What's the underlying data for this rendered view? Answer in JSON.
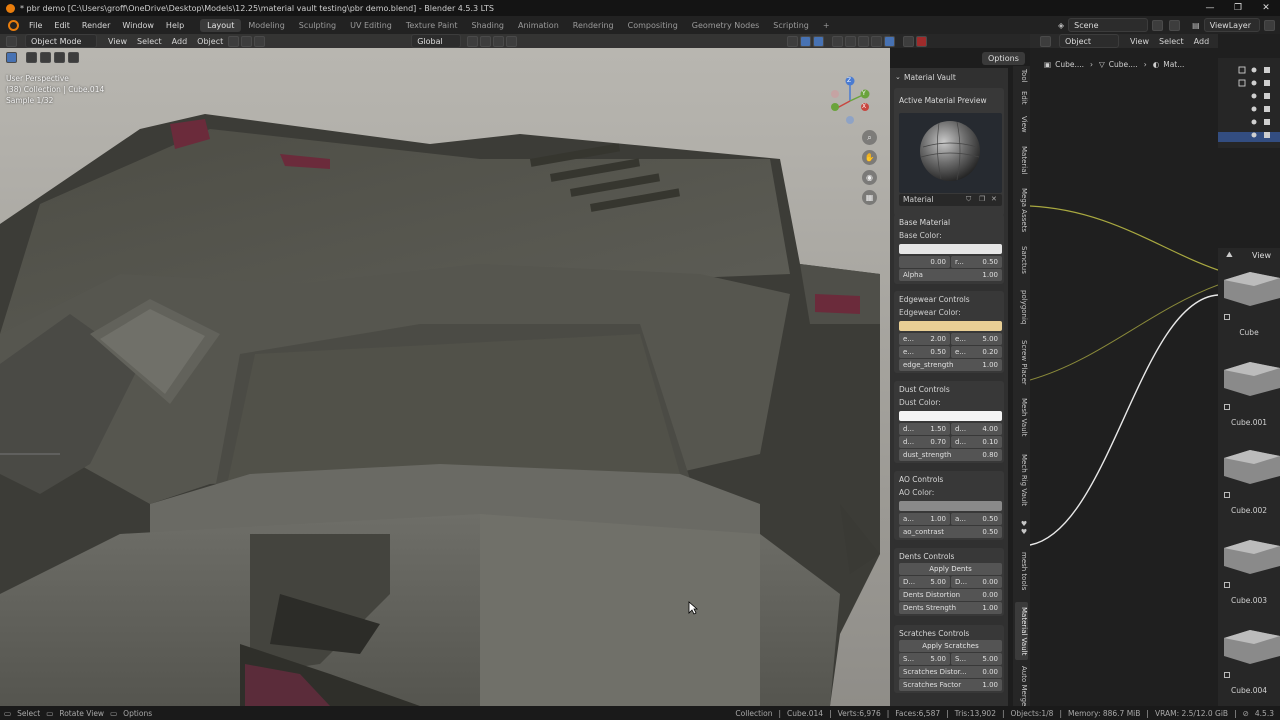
{
  "window": {
    "title": "* pbr demo [C:\\Users\\groff\\OneDrive\\Desktop\\Models\\12.25\\material vault testing\\pbr demo.blend] - Blender 4.5.3 LTS",
    "controls": [
      "—",
      "❐",
      "✕"
    ]
  },
  "menubar": {
    "menus": [
      "File",
      "Edit",
      "Render",
      "Window",
      "Help"
    ],
    "workspaces": [
      "Layout",
      "Modeling",
      "Sculpting",
      "UV Editing",
      "Texture Paint",
      "Shading",
      "Animation",
      "Rendering",
      "Compositing",
      "Geometry Nodes",
      "Scripting"
    ],
    "active_workspace": "Layout",
    "add_tab": "+",
    "scene": "Scene",
    "view_layer": "ViewLayer"
  },
  "viewport_header": {
    "mode": "Object Mode",
    "menus": [
      "View",
      "Select",
      "Add",
      "Object"
    ],
    "transform_orientation": "Global",
    "options": "Options"
  },
  "viewport_info": {
    "perspective": "User Perspective",
    "collection": "(38) Collection | Cube.014",
    "sample": "Sample 1/32"
  },
  "gizmo": {
    "x": "X",
    "y": "Y",
    "z": "Z"
  },
  "material_vault": {
    "panel_title": "Material Vault",
    "preview_label": "Active Material Preview",
    "material_name": "Material",
    "base": {
      "title": "Base Material",
      "color_label": "Base Color:",
      "color": "#e6e6e6",
      "f1_value": "0.00",
      "f2_label": "r...",
      "f2_value": "0.50",
      "alpha_label": "Alpha",
      "alpha_value": "1.00"
    },
    "edgewear": {
      "title": "Edgewear Controls",
      "color_label": "Edgewear Color:",
      "color": "#e9cf95",
      "r1": [
        {
          "label": "e...",
          "value": "2.00"
        },
        {
          "label": "e...",
          "value": "5.00"
        }
      ],
      "r2": [
        {
          "label": "e...",
          "value": "0.50"
        },
        {
          "label": "e...",
          "value": "0.20"
        }
      ],
      "strength_label": "edge_strength",
      "strength_value": "1.00"
    },
    "dust": {
      "title": "Dust Controls",
      "color_label": "Dust Color:",
      "color": "#f5f5f5",
      "r1": [
        {
          "label": "d...",
          "value": "1.50"
        },
        {
          "label": "d...",
          "value": "4.00"
        }
      ],
      "r2": [
        {
          "label": "d...",
          "value": "0.70"
        },
        {
          "label": "d...",
          "value": "0.10"
        }
      ],
      "strength_label": "dust_strength",
      "strength_value": "0.80"
    },
    "ao": {
      "title": "AO Controls",
      "color_label": "AO Color:",
      "color": "#8a8a8a",
      "r1": [
        {
          "label": "a...",
          "value": "1.00"
        },
        {
          "label": "a...",
          "value": "0.50"
        }
      ],
      "contrast_label": "ao_contrast",
      "contrast_value": "0.50"
    },
    "dents": {
      "title": "Dents Controls",
      "apply": "Apply Dents",
      "r1": [
        {
          "label": "D...",
          "value": "5.00"
        },
        {
          "label": "D...",
          "value": "0.00"
        }
      ],
      "distortion_label": "Dents Distortion",
      "distortion_value": "0.00",
      "strength_label": "Dents Strength",
      "strength_value": "1.00"
    },
    "scratches": {
      "title": "Scratches Controls",
      "apply": "Apply Scratches",
      "r1": [
        {
          "label": "S...",
          "value": "5.00"
        },
        {
          "label": "S...",
          "value": "5.00"
        }
      ],
      "distortion_label": "Scratches Distor...",
      "distortion_value": "0.00",
      "factor_label": "Scratches Factor",
      "factor_value": "1.00"
    }
  },
  "sidebar_tabs": [
    "Tool",
    "Edit",
    "View",
    "Material",
    "Mega Assets",
    "Sanctus",
    "polygoniq",
    "Screw Placer",
    "Mesh Vault",
    "Mech Rig Vault",
    "♥♥",
    "mesh tools",
    "Material Vault",
    "Auto Merge"
  ],
  "active_sidebar_tab": "Material Vault",
  "node_editor": {
    "object_dropdown": "Object",
    "menus": [
      "View",
      "Select",
      "Add"
    ],
    "breadcrumb": [
      "Cube....",
      "Cube....",
      "Mat..."
    ]
  },
  "asset_browser": {
    "view": "View",
    "items": [
      "Cube",
      "Cube.001",
      "Cube.002",
      "Cube.003",
      "Cube.004"
    ]
  },
  "statusbar": {
    "left": [
      "Select",
      "Rotate View",
      "Options"
    ],
    "right": [
      "Collection",
      "Cube.014",
      "Verts:6,976",
      "Faces:6,587",
      "Tris:13,902",
      "Objects:1/8",
      "Memory: 886.7 MiB",
      "VRAM: 2.5/12.0 GiB",
      "4.5.3"
    ]
  }
}
